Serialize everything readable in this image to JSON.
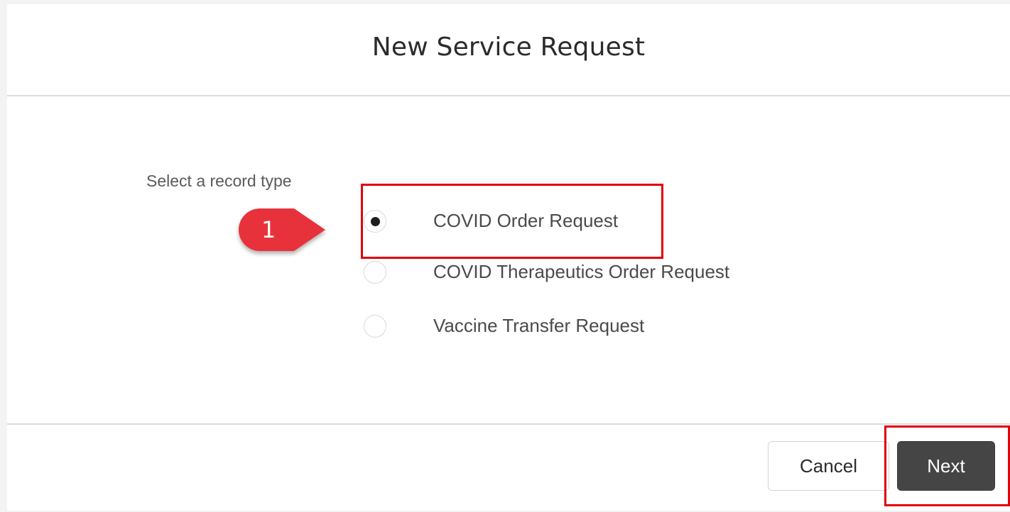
{
  "dialog": {
    "title": "New Service Request"
  },
  "record_type": {
    "label": "Select a record type",
    "options": [
      {
        "label": "COVID Order Request",
        "selected": true
      },
      {
        "label": "COVID Therapeutics Order Request",
        "selected": false
      },
      {
        "label": "Vaccine Transfer Request",
        "selected": false
      }
    ]
  },
  "footer": {
    "cancel_label": "Cancel",
    "next_label": "Next"
  },
  "annotation": {
    "step_number": "1",
    "callout_color": "#e8333b",
    "highlight_color": "#e0000a"
  }
}
